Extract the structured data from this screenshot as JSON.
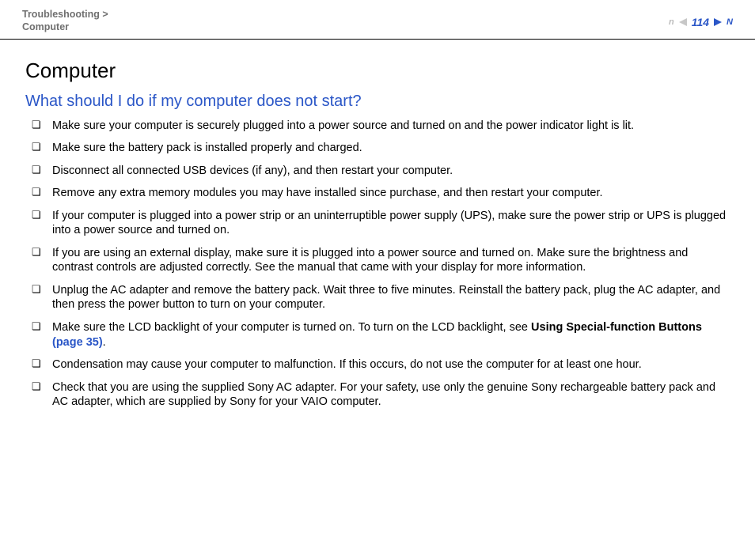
{
  "header": {
    "breadcrumb_line1": "Troubleshooting >",
    "breadcrumb_line2": "Computer",
    "page_number": "114",
    "prev_icon_name": "prev",
    "next_icon_name": "next",
    "letter": "n",
    "letterN": "N"
  },
  "content": {
    "h1": "Computer",
    "h2": "What should I do if my computer does not start?",
    "items": {
      "0": "Make sure your computer is securely plugged into a power source and turned on and the power indicator light is lit.",
      "1": "Make sure the battery pack is installed properly and charged.",
      "2": "Disconnect all connected USB devices (if any), and then restart your computer.",
      "3": "Remove any extra memory modules you may have installed since purchase, and then restart your computer.",
      "4": "If your computer is plugged into a power strip or an uninterruptible power supply (UPS), make sure the power strip or UPS is plugged into a power source and turned on.",
      "5": "If you are using an external display, make sure it is plugged into a power source and turned on. Make sure the brightness and contrast controls are adjusted correctly. See the manual that came with your display for more information.",
      "6": "Unplug the AC adapter and remove the battery pack. Wait three to five minutes. Reinstall the battery pack, plug the AC adapter, and then press the power button to turn on your computer.",
      "7_pre": "Make sure the LCD backlight of your computer is turned on. To turn on the LCD backlight, see ",
      "7_bold": "Using Special-function Buttons ",
      "7_link": "(page 35)",
      "7_post": ".",
      "8": "Condensation may cause your computer to malfunction. If this occurs, do not use the computer for at least one hour.",
      "9": "Check that you are using the supplied Sony AC adapter. For your safety, use only the genuine Sony rechargeable battery pack and AC adapter, which are supplied by Sony for your VAIO computer."
    }
  }
}
